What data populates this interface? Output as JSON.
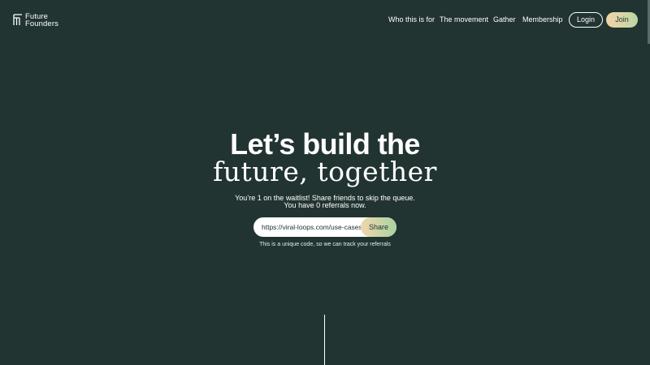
{
  "header": {
    "brand": {
      "line1": "Future",
      "line2": "Founders",
      "icon": "brand-logo-icon"
    },
    "nav": [
      {
        "label": "Who this is for"
      },
      {
        "label": "The movement"
      },
      {
        "label": "Gather"
      },
      {
        "label": "Membership"
      }
    ],
    "login_label": "Login",
    "join_label": "Join"
  },
  "hero": {
    "title": "Let’s build the",
    "subtitle": "future, together",
    "waitlist_line1": "You’re 1 on the waitlist! Share friends to skip the queue.",
    "waitlist_line2": "You have 0 referrals now."
  },
  "share": {
    "value": "https://viral-loops.com/use-cases/",
    "button_label": "Share",
    "note": "This is a unique code, so we can track your referrals"
  },
  "colors": {
    "background": "#213431",
    "text": "#ffffff",
    "accent_gradient_start": "#f2d4a6",
    "accent_gradient_end": "#b7d7a4"
  }
}
